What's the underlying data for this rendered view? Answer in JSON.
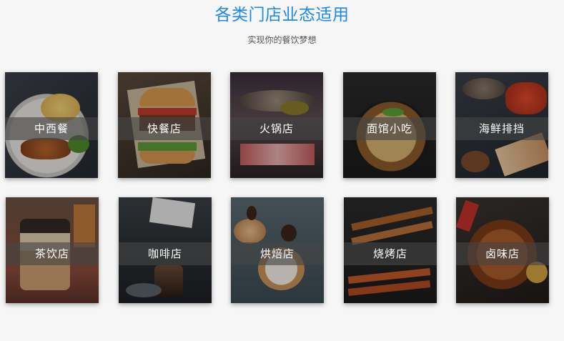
{
  "header": {
    "title": "各类门店业态适用",
    "subtitle": "实现你的餐饮梦想"
  },
  "stores": [
    {
      "label": "中西餐",
      "icon": "pasta-image"
    },
    {
      "label": "快餐店",
      "icon": "burger-image"
    },
    {
      "label": "火锅店",
      "icon": "hotpot-image"
    },
    {
      "label": "面馆小吃",
      "icon": "noodles-image"
    },
    {
      "label": "海鲜排挡",
      "icon": "seafood-image"
    },
    {
      "label": "茶饮店",
      "icon": "tea-drink-image"
    },
    {
      "label": "咖啡店",
      "icon": "coffee-image"
    },
    {
      "label": "烘焙店",
      "icon": "bakery-image"
    },
    {
      "label": "烧烤店",
      "icon": "bbq-image"
    },
    {
      "label": "卤味店",
      "icon": "braised-food-image"
    }
  ],
  "colors": {
    "title": "#1e88e5",
    "background": "#f6f6f6"
  }
}
